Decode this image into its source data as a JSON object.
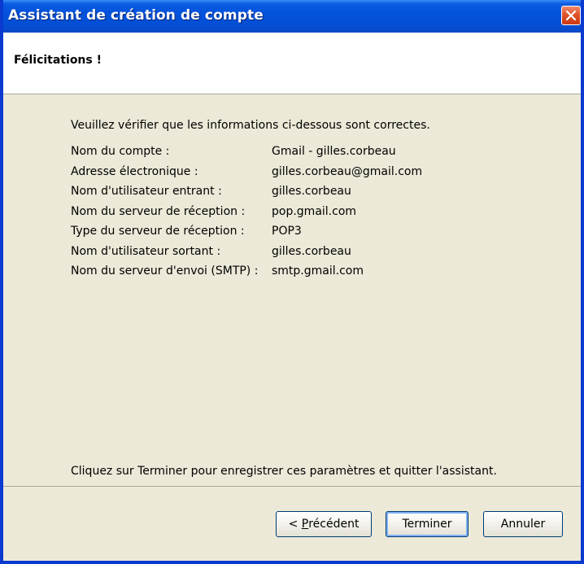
{
  "window": {
    "title": "Assistant de création de compte",
    "titlebar_color": "#0452dc",
    "close_icon": "close-icon"
  },
  "header": {
    "title": "Félicitations !"
  },
  "main": {
    "intro": "Veuillez vérifier que les informations ci-dessous sont correctes.",
    "rows": [
      {
        "label": "Nom du compte :",
        "value": "Gmail - gilles.corbeau"
      },
      {
        "label": "Adresse électronique :",
        "value": "gilles.corbeau@gmail.com"
      },
      {
        "label": "Nom d'utilisateur entrant :",
        "value": "gilles.corbeau"
      },
      {
        "label": "Nom du serveur de réception :",
        "value": "pop.gmail.com"
      },
      {
        "label": "Type du serveur de réception :",
        "value": "POP3"
      },
      {
        "label": "Nom d'utilisateur sortant :",
        "value": "gilles.corbeau"
      },
      {
        "label": "Nom du serveur d'envoi (SMTP) :",
        "value": "smtp.gmail.com"
      }
    ],
    "footer_message": "Cliquez sur Terminer pour enregistrer ces paramètres et quitter l'assistant."
  },
  "buttons": {
    "prev_prefix": "< ",
    "prev_accel": "P",
    "prev_rest": "récédent",
    "finish": "Terminer",
    "cancel": "Annuler"
  }
}
